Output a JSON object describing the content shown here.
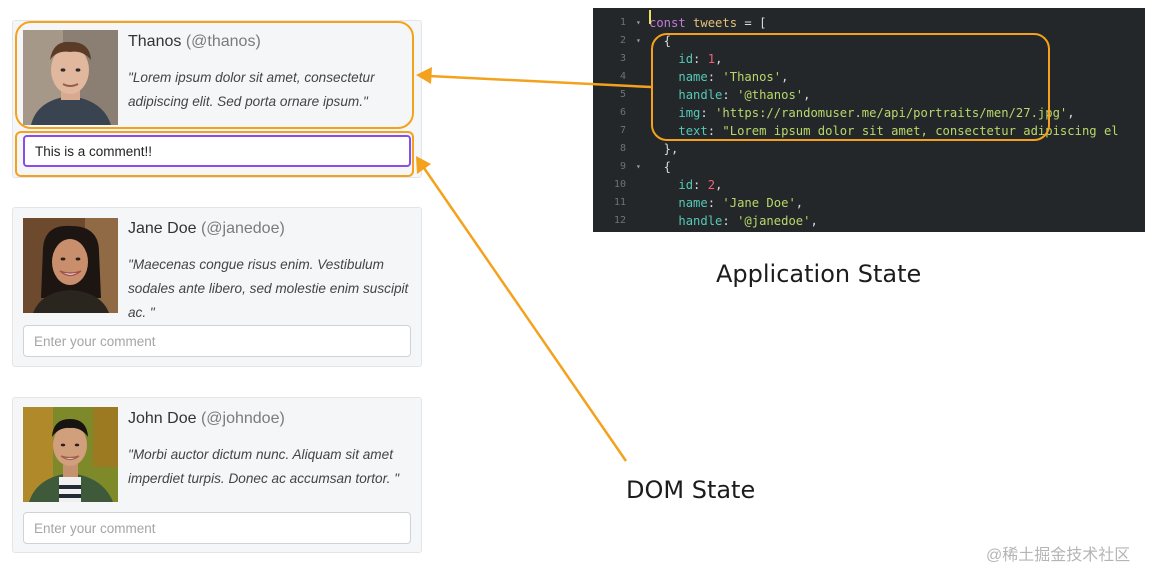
{
  "tweets": [
    {
      "name": "Thanos",
      "handle": "(@thanos)",
      "text": "\"Lorem ipsum dolor sit amet, consectetur adipiscing elit. Sed porta ornare ipsum.\"",
      "comment_value": "This is a comment!!",
      "comment_placeholder": ""
    },
    {
      "name": "Jane Doe",
      "handle": "(@janedoe)",
      "text": "\"Maecenas congue risus enim. Vestibulum sodales ante libero, sed molestie enim suscipit ac. \"",
      "comment_value": "",
      "comment_placeholder": "Enter your comment"
    },
    {
      "name": "John Doe",
      "handle": "(@johndoe)",
      "text": "\"Morbi auctor dictum nunc. Aliquam sit amet imperdiet turpis. Donec ac accumsan tortor. \"",
      "comment_value": "",
      "comment_placeholder": "Enter your comment"
    }
  ],
  "code": {
    "lines": [
      {
        "n": "1",
        "fold": "▾",
        "tokens": [
          [
            "kw",
            "const"
          ],
          [
            "p",
            " "
          ],
          [
            "id",
            "tweets"
          ],
          [
            "p",
            " = ["
          ]
        ]
      },
      {
        "n": "2",
        "fold": "▾",
        "tokens": [
          [
            "p",
            "  {"
          ]
        ]
      },
      {
        "n": "3",
        "fold": "",
        "tokens": [
          [
            "p",
            "    "
          ],
          [
            "key",
            "id"
          ],
          [
            "p",
            ": "
          ],
          [
            "num",
            "1"
          ],
          [
            "p",
            ","
          ]
        ]
      },
      {
        "n": "4",
        "fold": "",
        "tokens": [
          [
            "p",
            "    "
          ],
          [
            "key",
            "name"
          ],
          [
            "p",
            ": "
          ],
          [
            "str",
            "'Thanos'"
          ],
          [
            "p",
            ","
          ]
        ]
      },
      {
        "n": "5",
        "fold": "",
        "tokens": [
          [
            "p",
            "    "
          ],
          [
            "key",
            "handle"
          ],
          [
            "p",
            ": "
          ],
          [
            "str",
            "'@thanos'"
          ],
          [
            "p",
            ","
          ]
        ]
      },
      {
        "n": "6",
        "fold": "",
        "tokens": [
          [
            "p",
            "    "
          ],
          [
            "key",
            "img"
          ],
          [
            "p",
            ": "
          ],
          [
            "str",
            "'https://randomuser.me/api/portraits/men/27.jpg'"
          ],
          [
            "p",
            ","
          ]
        ]
      },
      {
        "n": "7",
        "fold": "",
        "tokens": [
          [
            "p",
            "    "
          ],
          [
            "key",
            "text"
          ],
          [
            "p",
            ": "
          ],
          [
            "str",
            "\"Lorem ipsum dolor sit amet, consectetur adipiscing el"
          ]
        ]
      },
      {
        "n": "8",
        "fold": "",
        "tokens": [
          [
            "p",
            "  },"
          ]
        ]
      },
      {
        "n": "9",
        "fold": "▾",
        "tokens": [
          [
            "p",
            "  {"
          ]
        ]
      },
      {
        "n": "10",
        "fold": "",
        "tokens": [
          [
            "p",
            "    "
          ],
          [
            "key",
            "id"
          ],
          [
            "p",
            ": "
          ],
          [
            "num",
            "2"
          ],
          [
            "p",
            ","
          ]
        ]
      },
      {
        "n": "11",
        "fold": "",
        "tokens": [
          [
            "p",
            "    "
          ],
          [
            "key",
            "name"
          ],
          [
            "p",
            ": "
          ],
          [
            "str",
            "'Jane Doe'"
          ],
          [
            "p",
            ","
          ]
        ]
      },
      {
        "n": "12",
        "fold": "",
        "tokens": [
          [
            "p",
            "    "
          ],
          [
            "key",
            "handle"
          ],
          [
            "p",
            ": "
          ],
          [
            "str",
            "'@janedoe'"
          ],
          [
            "p",
            ","
          ]
        ]
      }
    ]
  },
  "labels": {
    "application_state": "Application State",
    "dom_state": "DOM State"
  },
  "watermark": "@稀土掘金技术社区",
  "colors": {
    "highlight": "#f4a21d",
    "focus_border": "#8a4ee8",
    "editor_bg": "#232729"
  }
}
